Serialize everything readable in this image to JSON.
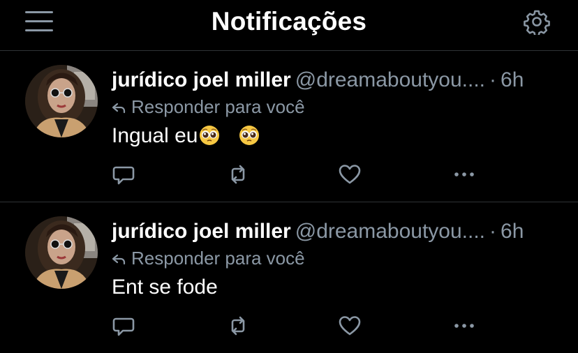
{
  "header": {
    "title": "Notificações",
    "menu_icon": "hamburger-menu-icon",
    "settings_icon": "gear-icon"
  },
  "colors": {
    "background": "#000000",
    "divider": "#2f3336",
    "secondary_text": "#8b98a5",
    "primary_text": "#ffffff"
  },
  "replies": [
    {
      "name": "jurídico joel miller",
      "handle": "@dreamaboutyou....",
      "separator": "·",
      "time": "6h",
      "reply_to": "Responder para você",
      "text": "Ingual eu",
      "emojis": [
        "pleading-face",
        "pleading-face"
      ],
      "actions": [
        "reply-icon",
        "retweet-icon",
        "heart-icon",
        "more-icon"
      ]
    },
    {
      "name": "jurídico joel miller",
      "handle": "@dreamaboutyou....",
      "separator": "·",
      "time": "6h",
      "reply_to": "Responder para você",
      "text": "Ent se fode",
      "emojis": [],
      "actions": [
        "reply-icon",
        "retweet-icon",
        "heart-icon",
        "more-icon"
      ]
    }
  ]
}
